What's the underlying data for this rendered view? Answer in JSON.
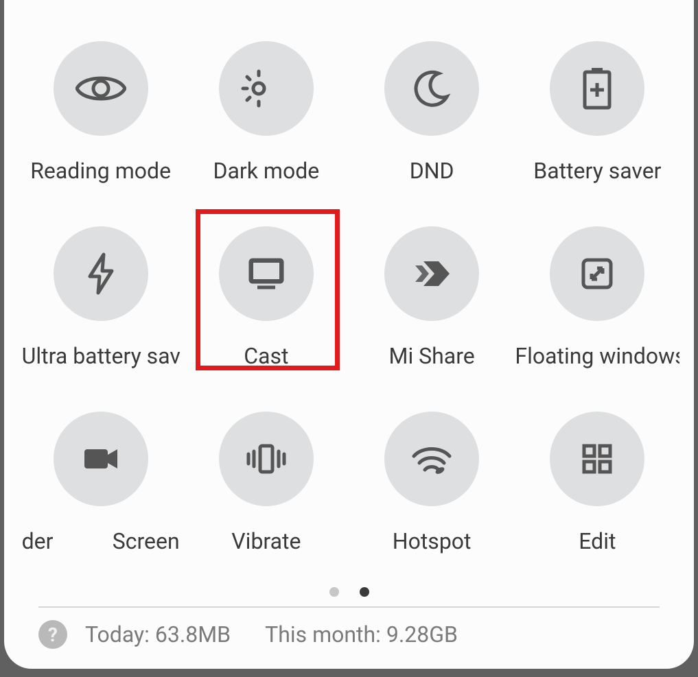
{
  "tiles": {
    "reading_mode": "Reading mode",
    "dark_mode": "Dark mode",
    "dnd": "DND",
    "battery_saver": "Battery saver",
    "ultra_battery_saver": "Ultra battery saver",
    "cast": "Cast",
    "mi_share": "Mi Share",
    "floating_windows": "Floating windows",
    "recorder_fragment": "der",
    "screen_fragment": "Screen",
    "vibrate": "Vibrate",
    "hotspot": "Hotspot",
    "edit": "Edit"
  },
  "highlight": {
    "tile": "cast"
  },
  "pager": {
    "total": 2,
    "active_index": 1
  },
  "footer": {
    "today_label": "Today: 63.8MB",
    "month_label": "This month: 9.28GB"
  }
}
